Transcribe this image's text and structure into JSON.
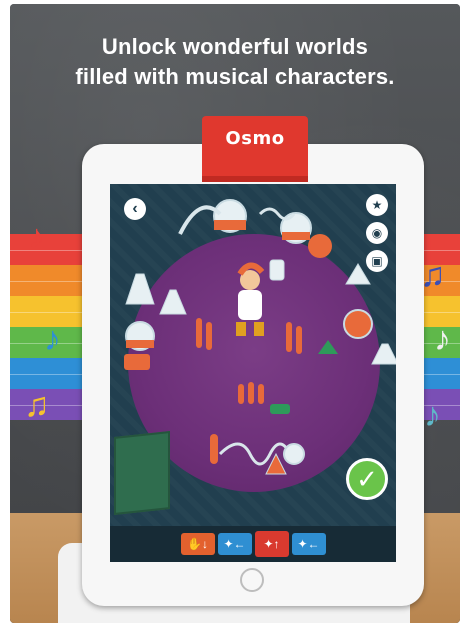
{
  "headline": {
    "line1": "Unlock wonderful worlds",
    "line2": "filled with musical characters."
  },
  "device": {
    "brand": "Osmo"
  },
  "colors": {
    "chalkboard": "#4a4d50",
    "screen": "#213f4f",
    "turntable": "#6c2f78",
    "reflector": "#e0382e",
    "check": "#6ac44a",
    "bands": [
      "#e8413a",
      "#f08a2a",
      "#f6c22e",
      "#5fb84a",
      "#2e8fd6",
      "#7a4fb5"
    ]
  },
  "icons": {
    "back": "back-arrow-icon",
    "side": [
      "star-icon",
      "record-icon",
      "square-stop-icon"
    ],
    "notes_left": [
      "♪",
      "♪",
      "♫"
    ],
    "notes_right": [
      "♫",
      "♪",
      "♪"
    ],
    "check": "checkmark-icon"
  },
  "toolbar": {
    "items": [
      {
        "icon": "hand-down-icon",
        "glyph": "✋↓"
      },
      {
        "icon": "walk-left-icon",
        "glyph": "✦←"
      },
      {
        "icon": "run-up-icon",
        "glyph": "✦↑"
      },
      {
        "icon": "walk-left-icon",
        "glyph": "✦←"
      }
    ]
  }
}
